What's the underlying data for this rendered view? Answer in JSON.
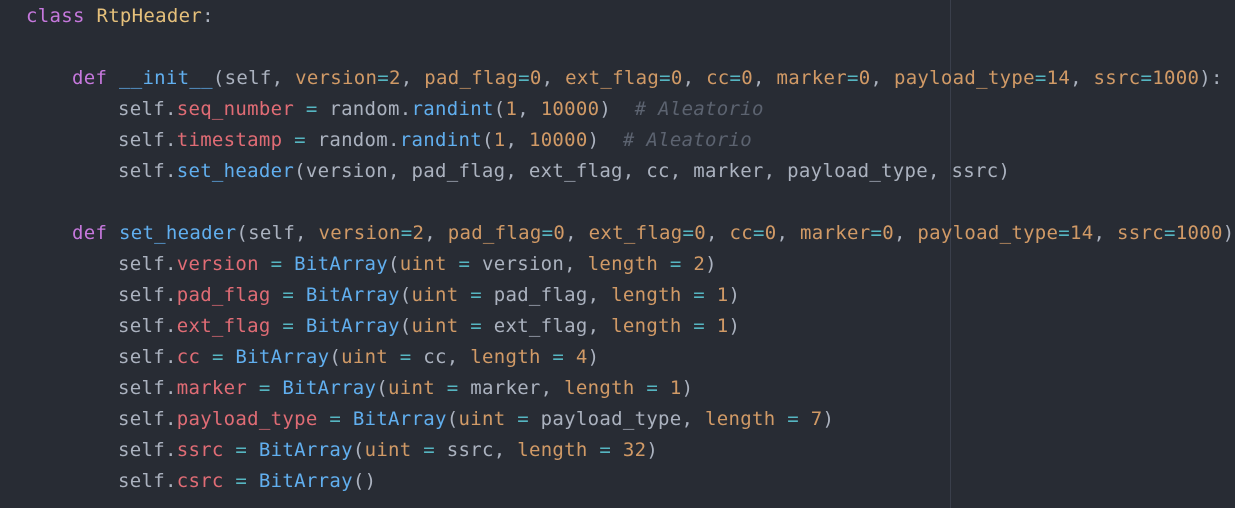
{
  "editor": {
    "colors": {
      "background": "#282c34",
      "keyword": "#c678dd",
      "class_name": "#e5c07b",
      "function": "#61afef",
      "attribute": "#e06c75",
      "parameter": "#d19a66",
      "number": "#d19a66",
      "operator": "#56b6c2",
      "text": "#abb2bf",
      "comment": "#5c6370"
    },
    "code": {
      "kw_class": "class",
      "class_name": "RtpHeader",
      "colon": ":",
      "kw_def": "def",
      "init_name": "__init__",
      "set_header_name": "set_header",
      "self": "self",
      "dot": ".",
      "eq_spaced": " = ",
      "eq": "=",
      "comma": ", ",
      "paren_open": "(",
      "paren_close": ")",
      "close_colon": "):",
      "open_self": "(self, ",
      "p_version": "version",
      "p_pad_flag": "pad_flag",
      "p_ext_flag": "ext_flag",
      "p_cc": "cc",
      "p_marker": "marker",
      "p_payload_type": "payload_type",
      "p_ssrc": "ssrc",
      "n_2": "2",
      "n_0": "0",
      "n_14": "14",
      "n_1000": "1000",
      "n_1": "1",
      "n_10000": "10000",
      "n_4": "4",
      "n_7": "7",
      "n_32": "32",
      "a_seq_number": "seq_number",
      "a_timestamp": "timestamp",
      "a_version": "version",
      "a_pad_flag": "pad_flag",
      "a_ext_flag": "ext_flag",
      "a_cc": "cc",
      "a_marker": "marker",
      "a_payload_type": "payload_type",
      "a_ssrc": "ssrc",
      "a_csrc": "csrc",
      "random_mod": "random",
      "randint": "randint",
      "comment_aleatorio": "  # Aleatorio",
      "set_header_call_args": "(version, pad_flag, ext_flag, cc, marker, payload_type, ssrc)",
      "bitarray": "BitArray",
      "uint": "uint",
      "length": "length",
      "empty_call": "()"
    }
  }
}
